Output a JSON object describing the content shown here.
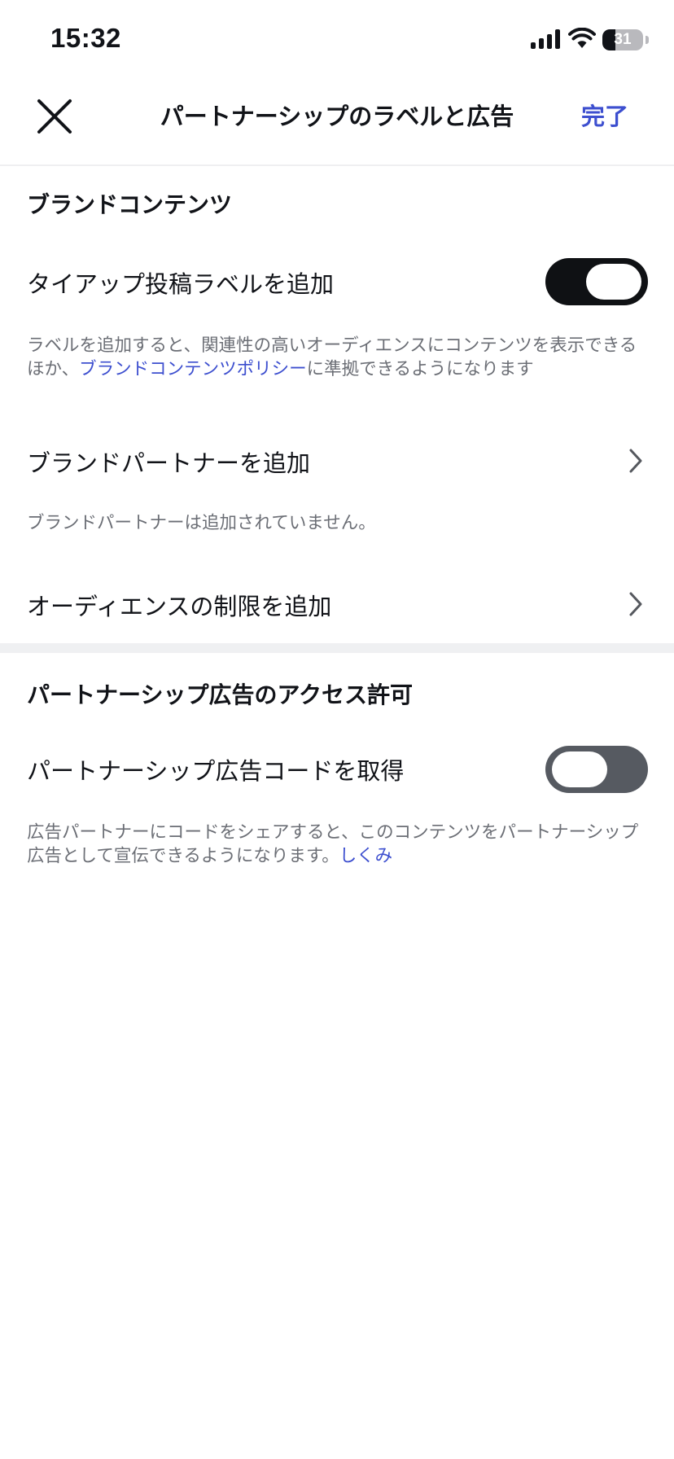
{
  "status_bar": {
    "time": "15:32",
    "battery": "31",
    "battery_level": 0.31,
    "icons": [
      "signal-icon",
      "wifi-icon",
      "battery-icon"
    ]
  },
  "header": {
    "title": "パートナーシップのラベルと広告",
    "done_label": "完了",
    "close_icon": "close-icon"
  },
  "branded_content": {
    "title": "ブランドコンテンツ",
    "tieup_label": "タイアップ投稿ラベルを追加",
    "tieup_toggle_on": true,
    "tieup_desc_before": "ラベルを追加すると、関連性の高いオーディエンスにコンテンツを表示できるほか、",
    "tieup_desc_link": "ブランドコンテンツポリシー",
    "tieup_desc_after": "に準拠できるようになります",
    "brand_partner_label": "ブランドパートナーを追加",
    "brand_partner_desc": "ブランドパートナーは追加されていません。",
    "audience_label": "オーディエンスの制限を追加"
  },
  "partnership_ads": {
    "title": "パートナーシップ広告のアクセス許可",
    "code_label": "パートナーシップ広告コードを取得",
    "code_toggle_on": false,
    "code_desc": "広告パートナーにコードをシェアすると、このコンテンツをパートナーシップ広告として宣伝できるようになります。",
    "code_desc_link": "しくみ"
  },
  "colors": {
    "accent": "#3d4fcf",
    "toggle_on": "#0f1114",
    "toggle_off": "#565a61",
    "secondary_text": "#6b6e75",
    "section_divider": "#eff0f2"
  }
}
